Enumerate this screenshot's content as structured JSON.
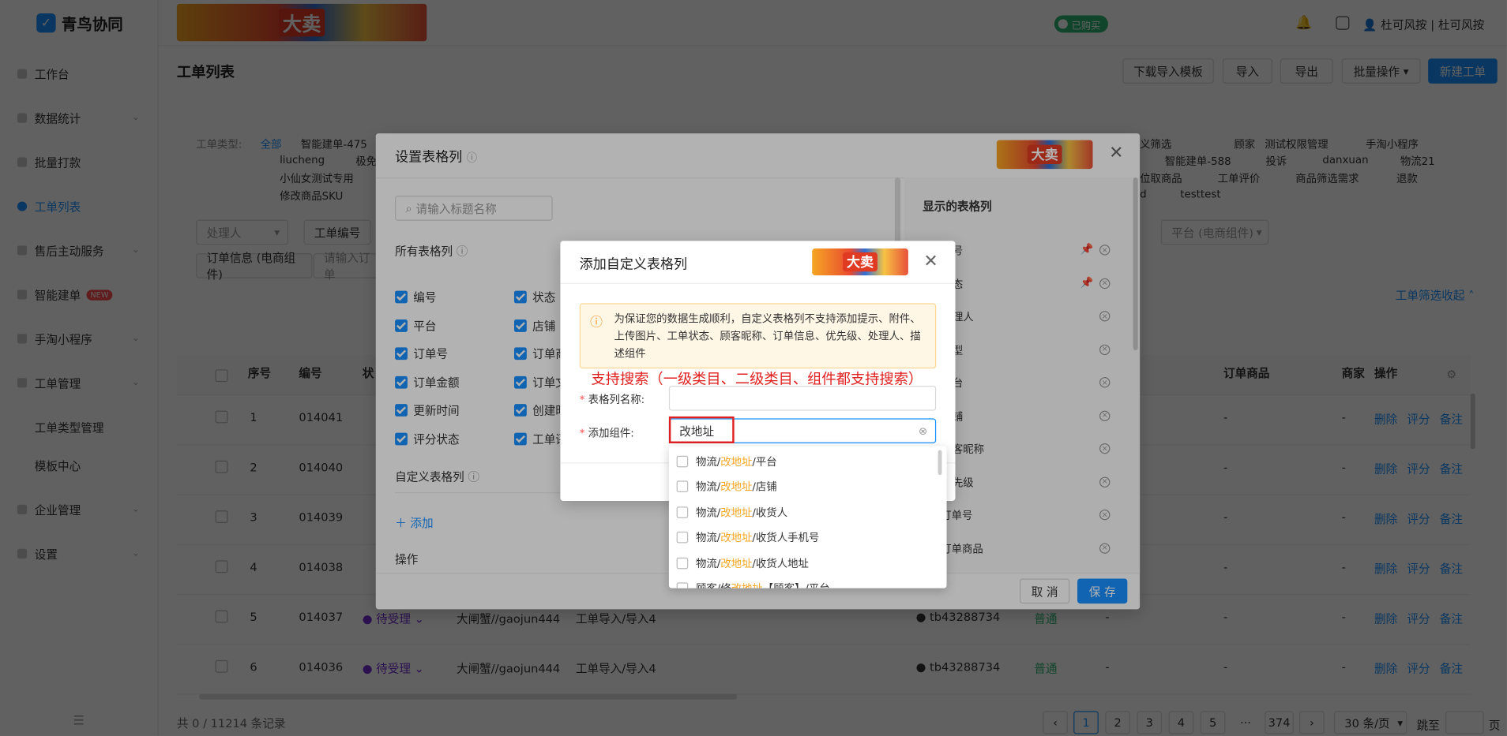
{
  "app": {
    "name": "青鸟协同",
    "banner_text": "大卖"
  },
  "sidebar": {
    "items": [
      {
        "label": "工作台",
        "chevron": false
      },
      {
        "label": "数据统计",
        "chevron": true
      },
      {
        "label": "批量打款",
        "chevron": false
      },
      {
        "label": "工单列表",
        "chevron": false,
        "active": true
      },
      {
        "label": "售后主动服务",
        "chevron": true
      },
      {
        "label": "智能建单",
        "chevron": false,
        "badge": "NEW"
      },
      {
        "label": "手淘小程序",
        "chevron": true
      },
      {
        "label": "工单管理",
        "chevron": true
      },
      {
        "label": "工单类型管理",
        "sub": true
      },
      {
        "label": "模板中心",
        "sub": true
      },
      {
        "label": "企业管理",
        "chevron": true
      },
      {
        "label": "设置",
        "chevron": true
      }
    ],
    "collapse_icon": "menu-fold-icon"
  },
  "topbar": {
    "purchased": "已购买",
    "user": "杜可风按 | 杜可风按"
  },
  "page": {
    "title": "工单列表",
    "buttons": {
      "download_template": "下载导入模板",
      "import": "导入",
      "export": "导出",
      "batch": "批量操作",
      "new": "新建工单"
    }
  },
  "filters": {
    "type_label": "工单类型:",
    "all": "全部",
    "row1": [
      "智能建单-475"
    ],
    "row1_right": [
      "义筛选",
      "顾家",
      "测试权限管理",
      "手淘小程序"
    ],
    "row2": [
      "liucheng",
      "极免"
    ],
    "row2_right": [
      "智能建单-588",
      "投诉",
      "danxuan",
      "物流21"
    ],
    "row3": [
      "小仙女测试专用"
    ],
    "row3_right": [
      "位取商品",
      "工单评价",
      "商品筛选需求",
      "退款"
    ],
    "row4": [
      "修改商品SKU"
    ],
    "row4_right": [
      "d",
      "testtest"
    ],
    "handler": "处理人",
    "order_no": "工单编号",
    "platform": "平台 (电商组件)",
    "order_info": "订单信息 (电商组件)",
    "order_info_ph": "请输入订单",
    "collapse": "工单筛选收起"
  },
  "table": {
    "headers": {
      "seq": "序号",
      "no": "编号",
      "status": "状",
      "order_goods": "订单商品",
      "merchant": "商家",
      "ops": "操作"
    },
    "rows": [
      {
        "seq": "1",
        "no": "014041",
        "dash1": "-",
        "dash2": "-"
      },
      {
        "seq": "2",
        "no": "014040",
        "dash1": "-",
        "dash2": "-"
      },
      {
        "seq": "3",
        "no": "014039",
        "dash1": "-",
        "dash2": "-"
      },
      {
        "seq": "4",
        "no": "014038",
        "dash1": "-",
        "dash2": "-"
      },
      {
        "seq": "5",
        "no": "014037",
        "status": "待受理",
        "customer": "大闸蟹//gaojun444",
        "source": "工单导入/导入4",
        "buyer": "tb43288734",
        "priority": "普通",
        "dash0": "-",
        "dash1": "-",
        "dash2": "-"
      },
      {
        "seq": "6",
        "no": "014036",
        "status": "待受理",
        "customer": "大闸蟹//gaojun444",
        "source": "工单导入/导入4",
        "buyer": "tb43288734",
        "priority": "普通",
        "dash0": "-",
        "dash1": "-",
        "dash2": "-"
      }
    ],
    "ops": {
      "delete": "删除",
      "rate": "评分",
      "note": "备注"
    }
  },
  "footer": {
    "total": "共 0 / 11214 条记录",
    "pages": [
      "1",
      "2",
      "3",
      "4",
      "5",
      "···",
      "374"
    ],
    "page_size": "30 条/页",
    "jump": "跳至",
    "page_unit": "页"
  },
  "settings_dialog": {
    "title": "设置表格列",
    "search_ph": "请输入标题名称",
    "all_cols": "所有表格列",
    "cols_left": [
      "编号",
      "平台",
      "订单号",
      "订单金额",
      "更新时间",
      "评分状态"
    ],
    "cols_right": [
      "状态",
      "店铺",
      "订单商",
      "订单文",
      "创建时",
      "工单评"
    ],
    "custom_cols": "自定义表格列",
    "add": "添加",
    "ops_label": "操作",
    "shown_cols": "显示的表格列",
    "shown_items": [
      "号",
      "态",
      "理人",
      "型",
      "台",
      "铺",
      "客昵称",
      "先级",
      "订单号",
      "订单商品"
    ],
    "cancel": "取 消",
    "save": "保 存"
  },
  "add_dialog": {
    "title": "添加自定义表格列",
    "notice": "为保证您的数据生成顺利，自定义表格列不支持添加提示、附件、上传图片、工单状态、顾客昵称、订单信息、优先级、处理人、描述组件",
    "annotation": "支持搜索（一级类目、二级类目、组件都支持搜索）",
    "name_label": "表格列名称:",
    "component_label": "添加组件:",
    "component_value": "改地址",
    "options": [
      {
        "pre": "物流/",
        "hl": "改地址",
        "post": "/平台"
      },
      {
        "pre": "物流/",
        "hl": "改地址",
        "post": "/店铺"
      },
      {
        "pre": "物流/",
        "hl": "改地址",
        "post": "/收货人"
      },
      {
        "pre": "物流/",
        "hl": "改地址",
        "post": "/收货人手机号"
      },
      {
        "pre": "物流/",
        "hl": "改地址",
        "post": "/收货人地址"
      },
      {
        "pre": "顾客/修",
        "hl": "改地址",
        "post": "【顾客】/平台"
      }
    ]
  },
  "colors": {
    "primary": "#1890ff",
    "highlight": "#f5a623",
    "annotation": "#e02020",
    "mask": "rgba(0,0,0,0.45)"
  }
}
